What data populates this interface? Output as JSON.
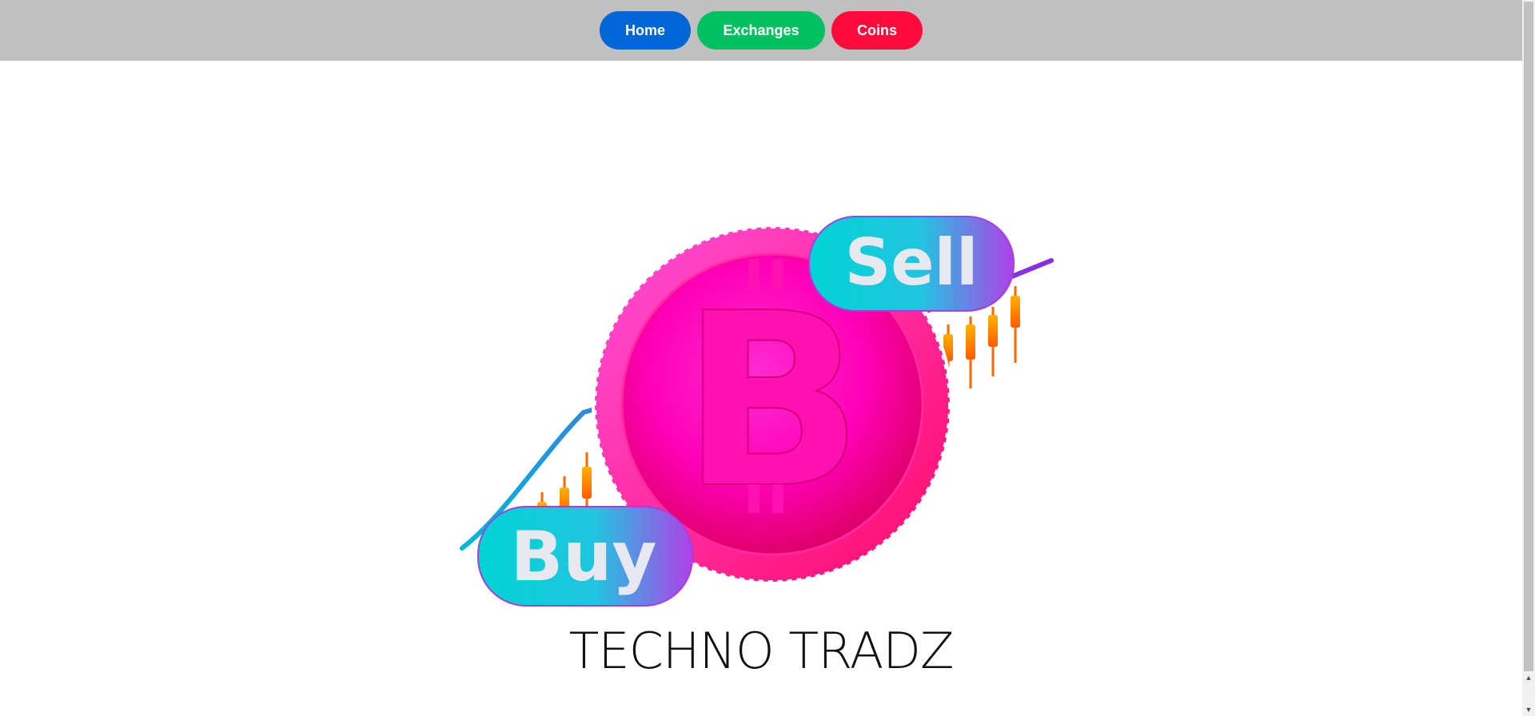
{
  "nav": {
    "home_label": "Home",
    "exchanges_label": "Exchanges",
    "coins_label": "Coins",
    "colors": {
      "home": "#0066d6",
      "exchanges": "#00c061",
      "coins": "#ff0a3c",
      "bar": "#c0c0c0"
    }
  },
  "hero": {
    "image_icon": "bitcoin-buy-sell-illustration",
    "buy_text": "Buy",
    "sell_text": "Sell",
    "brand_title": "TECHNO TRADZ"
  }
}
